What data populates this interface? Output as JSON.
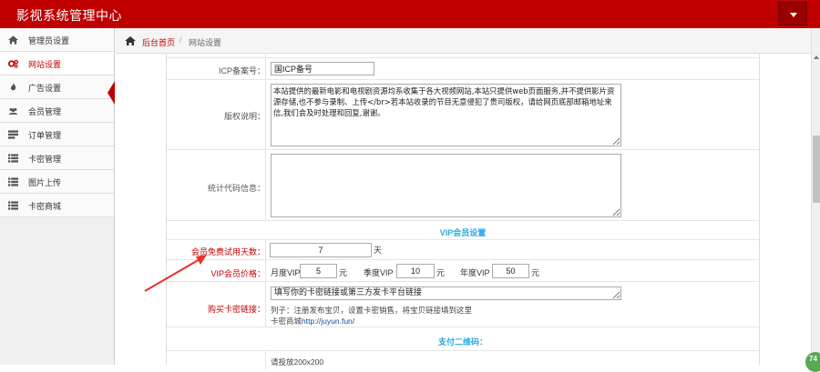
{
  "app": {
    "title": "影视系统管理中心"
  },
  "sidebar": {
    "items": [
      {
        "label": "管理员设置",
        "icon": "home-icon"
      },
      {
        "label": "网站设置",
        "icon": "gears-icon",
        "active": true
      },
      {
        "label": "广告设置",
        "icon": "fire-icon"
      },
      {
        "label": "会员管理",
        "icon": "users-icon"
      },
      {
        "label": "订单管理",
        "icon": "orders-icon"
      },
      {
        "label": "卡密管理",
        "icon": "list-icon"
      },
      {
        "label": "图片上传",
        "icon": "list-icon"
      },
      {
        "label": "卡密商城",
        "icon": "list-icon"
      }
    ]
  },
  "breadcrumb": {
    "home": "后台首页",
    "separator": "/",
    "current": "网站设置"
  },
  "form": {
    "icp_label": "ICP备案号：",
    "icp_value": "国ICP备号",
    "copyright_label": "版权说明：",
    "copyright_value": "本站提供的最新电影和电视剧资源均系收集于各大视频网站,本站只提供web页面服务,并不提供影片资源存储,也不参与录制、上传</br>若本站收录的节目无意侵犯了贵司版权，请给网页底部邮箱地址来信,我们会及时处理和回复,谢谢。",
    "stats_label": "统计代码信息：",
    "stats_value": "",
    "vip_section_title": "VIP会员设置",
    "trial_label": "会员免费试用天数：",
    "trial_value": "7",
    "trial_unit": "天",
    "price_label": "VIP会员价格：",
    "monthly_label": "月度VIP",
    "monthly_value": "5",
    "quarterly_label": "季度VIP",
    "quarterly_value": "10",
    "yearly_label": "年度VIP",
    "yearly_value": "50",
    "currency_unit": "元",
    "buy_link_label": "购买卡密链接：",
    "buy_link_value": "填写你的卡密链接或第三方发卡平台链接",
    "buy_link_hint": "列子：注册发布宝贝，设置卡密销售，将宝贝链接填到这里",
    "buy_link_example_prefix": "卡密商城",
    "buy_link_example_url": "http://juyun.fun/",
    "pay_section_title": "支付二维码：",
    "qr_hint": "请投放200x200"
  },
  "badge": {
    "text": "74"
  },
  "colors": {
    "brand": "#c00000",
    "section_title": "#29a9e0",
    "badge": "#5aa854"
  }
}
